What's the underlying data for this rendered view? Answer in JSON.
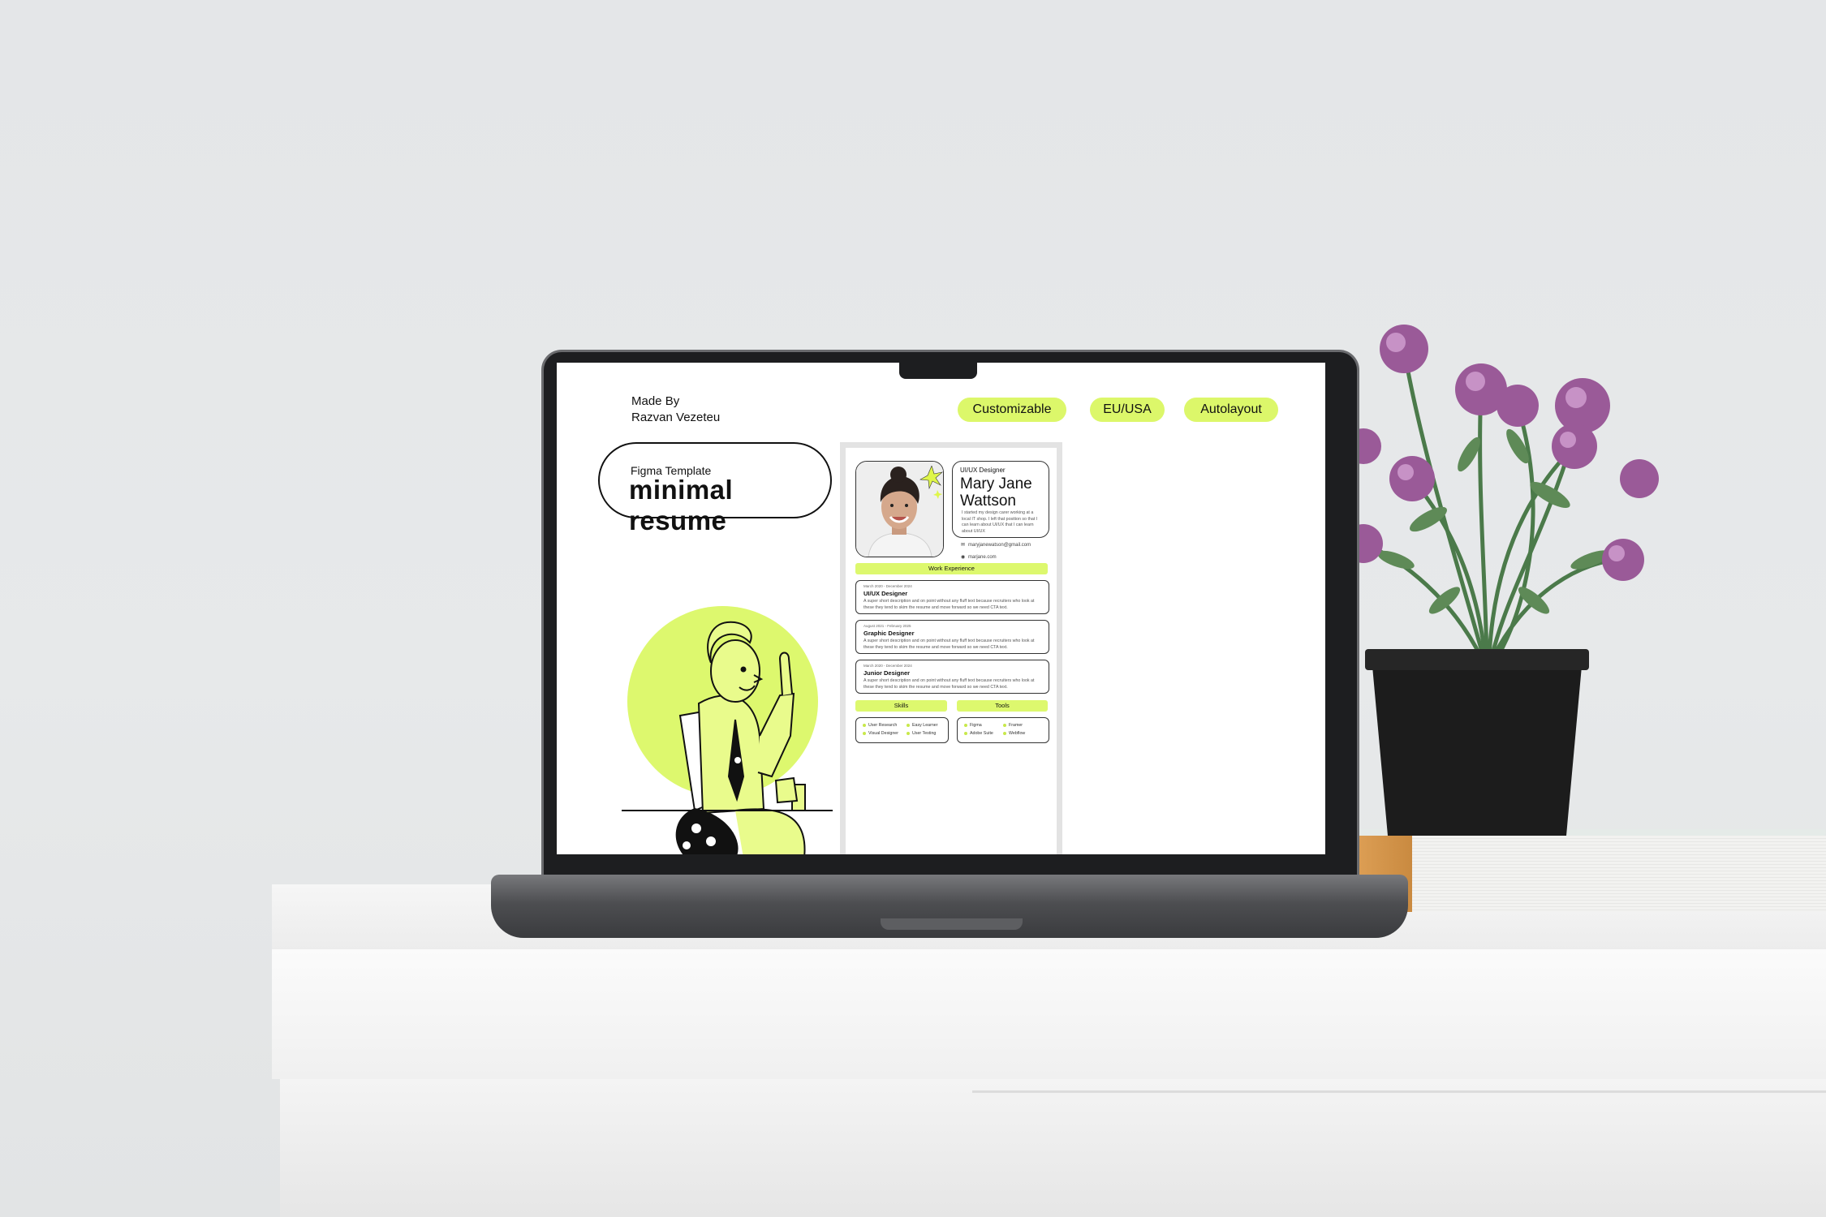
{
  "header": {
    "made_by_label": "Made By",
    "author": "Razvan Vezeteu"
  },
  "tags": [
    "Customizable",
    "EU/USA",
    "Autolayout"
  ],
  "hero": {
    "subtitle": "Figma Template",
    "title": "minimal resume"
  },
  "resume": {
    "role": "UI/UX Designer",
    "name_line1": "Mary Jane",
    "name_line2": "Wattson",
    "bio": "I started my design carer working at a local IT shop. I left that position so that I can learn about UI/UX that I can learn about UI/UX",
    "email": "maryjanewatson@gmail.com",
    "website": "marjane.com",
    "work_experience_label": "Work Experience",
    "jobs": [
      {
        "dates": "March 2020 - December 2024",
        "title": "UI/UX Designer",
        "desc": "A super short description and on point without any fluff text because recruiters who look at these they tend to skim the resume and move forward so we need CTA text."
      },
      {
        "dates": "August 2021 - February 2025",
        "title": "Graphic Designer",
        "desc": "A super short description and on point without any fluff text because recruiters who look at these they tend to skim the resume and move forward so we need CTA text."
      },
      {
        "dates": "March 2020 - December 2024",
        "title": "Junior Designer",
        "desc": "A super short description and on point without any fluff text because recruiters who look at these they tend to skim the resume and move forward so we need CTA text."
      }
    ],
    "skills_label": "Skills",
    "tools_label": "Tools",
    "skills": [
      "User Research",
      "Easy Learner",
      "Visual Designer",
      "User Testing"
    ],
    "tools": [
      "Figma",
      "Framer",
      "Adobe Suite",
      "Webflow"
    ]
  },
  "colors": {
    "accent": "#ddf86e",
    "text": "#111111"
  },
  "icons": [
    "email-icon",
    "globe-icon",
    "sparkle-icon"
  ]
}
